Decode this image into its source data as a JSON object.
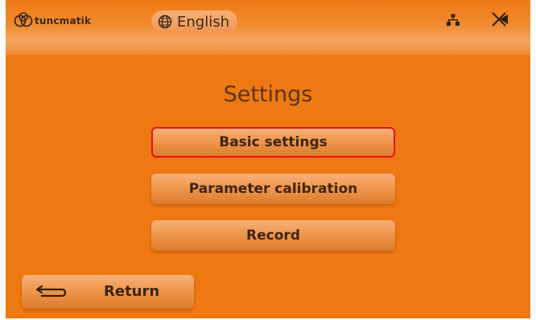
{
  "header": {
    "brand": "tuncmatik",
    "language": "English",
    "icons": [
      "globe-icon",
      "network-icon",
      "disconnected-icon"
    ]
  },
  "page": {
    "title": "Settings"
  },
  "menu": {
    "items": [
      {
        "label": "Basic settings",
        "selected": true
      },
      {
        "label": "Parameter calibration",
        "selected": false
      },
      {
        "label": "Record",
        "selected": false
      }
    ]
  },
  "footer": {
    "return_label": "Return",
    "icon": "return-arrow-icon"
  },
  "colors": {
    "background": "#ee7812",
    "button": "#f19a52",
    "selection_border": "#e8101a",
    "text": "#3d2512"
  }
}
